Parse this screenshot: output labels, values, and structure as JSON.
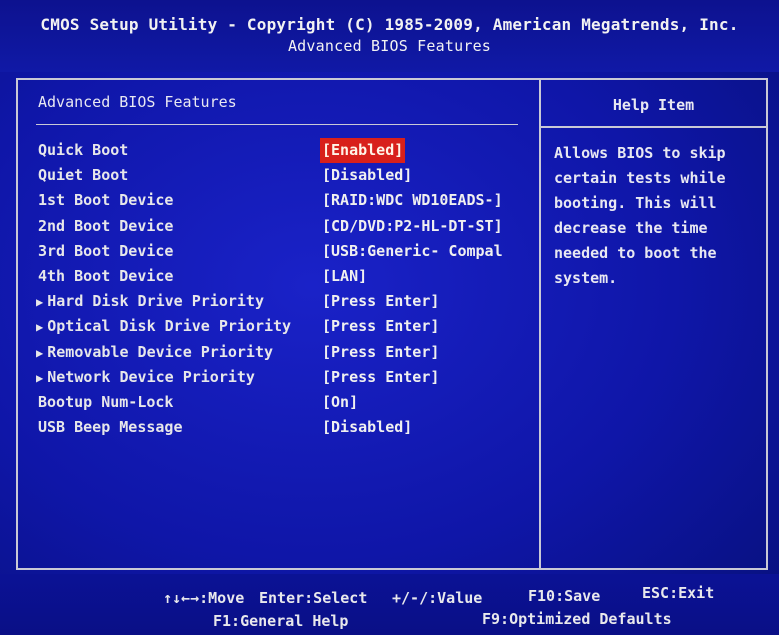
{
  "header": {
    "line1": "CMOS Setup Utility - Copyright (C) 1985-2009, American Megatrends, Inc.",
    "line2": "Advanced BIOS Features"
  },
  "panel": {
    "title": "Advanced BIOS Features"
  },
  "help": {
    "title": "Help Item",
    "lines": [
      "Allows BIOS to skip",
      "certain tests while",
      "booting. This will",
      "decrease the time",
      "needed to boot the",
      "system."
    ]
  },
  "items": [
    {
      "label": "Quick Boot",
      "value": "[Enabled]",
      "submenu": false,
      "selected": true
    },
    {
      "label": "Quiet Boot",
      "value": "[Disabled]",
      "submenu": false,
      "selected": false
    },
    {
      "label": "1st Boot Device",
      "value": "[RAID:WDC WD10EADS-]",
      "submenu": false,
      "selected": false
    },
    {
      "label": "2nd Boot Device",
      "value": "[CD/DVD:P2-HL-DT-ST]",
      "submenu": false,
      "selected": false
    },
    {
      "label": "3rd Boot Device",
      "value": "[USB:Generic- Compal",
      "submenu": false,
      "selected": false
    },
    {
      "label": "4th Boot Device",
      "value": "[LAN]",
      "submenu": false,
      "selected": false
    },
    {
      "label": "Hard Disk Drive Priority",
      "value": "[Press Enter]",
      "submenu": true,
      "selected": false
    },
    {
      "label": "Optical Disk Drive Priority",
      "value": "[Press Enter]",
      "submenu": true,
      "selected": false
    },
    {
      "label": "Removable Device Priority",
      "value": "[Press Enter]",
      "submenu": true,
      "selected": false
    },
    {
      "label": "Network Device Priority",
      "value": "[Press Enter]",
      "submenu": true,
      "selected": false
    },
    {
      "label": "Bootup Num-Lock",
      "value": "[On]",
      "submenu": false,
      "selected": false
    },
    {
      "label": "USB Beep Message",
      "value": "[Disabled]",
      "submenu": false,
      "selected": false
    }
  ],
  "footer": {
    "move": "↑↓←→:Move",
    "select": "Enter:Select",
    "value": "+/-/:Value",
    "save": "F10:Save",
    "exit": "ESC:Exit",
    "help": "F1:General Help",
    "defaults": "F9:Optimized Defaults"
  },
  "colors": {
    "background": "#0f16a8",
    "border": "#c9c9d6",
    "highlight": "#d8201b",
    "text": "#e8e8e8"
  },
  "icons": {
    "submenu": "triangle-right-icon"
  }
}
